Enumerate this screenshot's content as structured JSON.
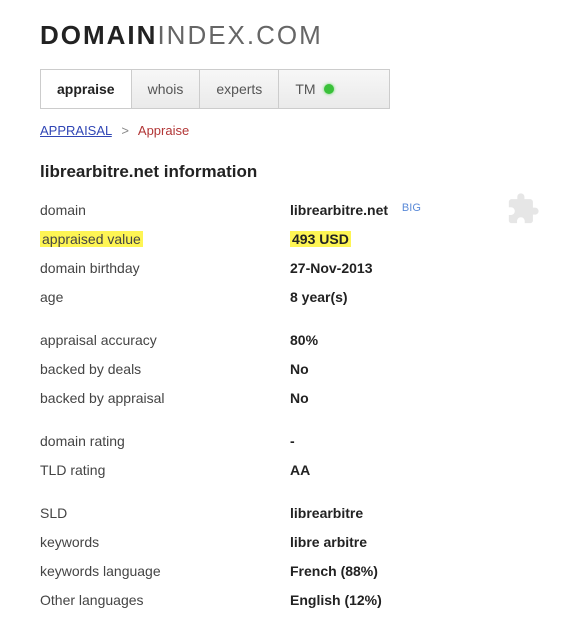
{
  "logo": {
    "bold": "DOMAIN",
    "thin": "INDEX.COM"
  },
  "tabs": {
    "appraise": "appraise",
    "whois": "whois",
    "experts": "experts",
    "tm": "TM"
  },
  "breadcrumb": {
    "root": "APPRAISAL",
    "sep": ">",
    "current": "Appraise"
  },
  "page_title": "librearbitre.net information",
  "big_label": "BIG",
  "rows": {
    "domain": {
      "label": "domain",
      "value": "librearbitre.net"
    },
    "appraised_value": {
      "label": "appraised value",
      "value": "493 USD"
    },
    "birthday": {
      "label": "domain birthday",
      "value": "27-Nov-2013"
    },
    "age": {
      "label": "age",
      "value": "8 year(s)"
    },
    "accuracy": {
      "label": "appraisal accuracy",
      "value": "80%"
    },
    "backed_deals": {
      "label": "backed by deals",
      "value": "No"
    },
    "backed_appraisal": {
      "label": "backed by appraisal",
      "value": "No"
    },
    "domain_rating": {
      "label": "domain rating",
      "value": "-"
    },
    "tld_rating": {
      "label": "TLD rating",
      "value": "AA"
    },
    "sld": {
      "label": "SLD",
      "value": "librearbitre"
    },
    "keywords": {
      "label": "keywords",
      "value": "libre arbitre"
    },
    "keywords_lang": {
      "label": "keywords language",
      "value": "French (88%)"
    },
    "other_lang": {
      "label": "Other languages",
      "value": "English (12%)"
    }
  }
}
